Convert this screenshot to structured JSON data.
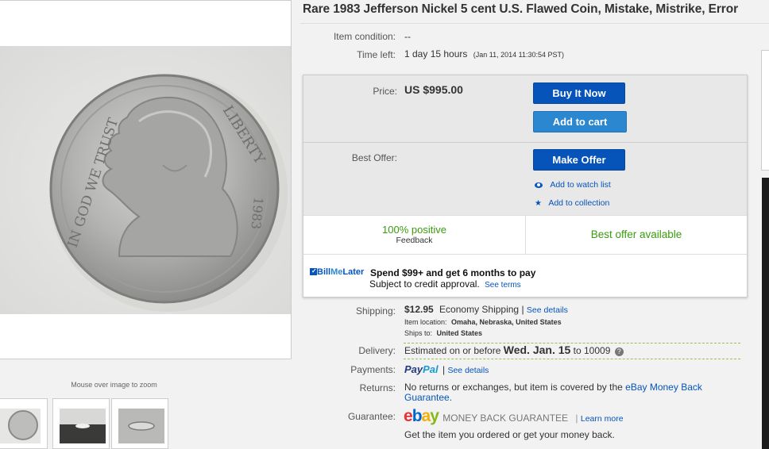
{
  "listing": {
    "title": "Rare 1983 Jefferson Nickel 5 cent U.S. Flawed Coin, Mistake, Mistrike, Error"
  },
  "gallery": {
    "zoom_hint": "Mouse over image to zoom",
    "coin_legend_left": "IN GOD WE TRUST",
    "coin_legend_right": "LIBERTY",
    "coin_year": "1983"
  },
  "details": {
    "item_condition_label": "Item condition:",
    "item_condition_value": "--",
    "time_left_label": "Time left:",
    "time_left_value": "1 day 15 hours",
    "time_left_end": "(Jan 11, 2014  11:30:54 PST)"
  },
  "buy_box": {
    "price_label": "Price:",
    "price_value": "US $995.00",
    "buy_now_label": "Buy It Now",
    "add_to_cart_label": "Add to cart",
    "best_offer_label": "Best Offer:",
    "make_offer_label": "Make Offer",
    "watch_label": "Add to watch list",
    "collection_label": "Add to collection",
    "feedback_percent": "100% positive",
    "feedback_label": "Feedback",
    "best_offer_available": "Best offer available",
    "bml_logo_bill": "Bill",
    "bml_logo_me": "Me",
    "bml_logo_later": "Later",
    "bml_headline": "Spend $99+ and get 6 months to pay",
    "bml_subtext": "Subject to credit approval.",
    "bml_terms_link": "See terms"
  },
  "shipping": {
    "shipping_label": "Shipping:",
    "shipping_cost": "$12.95",
    "shipping_method": "Economy Shipping |",
    "shipping_details_link": "See details",
    "item_location_label": "Item location:",
    "item_location_value": "Omaha, Nebraska, United States",
    "ships_to_label": "Ships to:",
    "ships_to_value": "United States",
    "delivery_label": "Delivery:",
    "delivery_prefix": "Estimated on or before",
    "delivery_date": "Wed. Jan. 15",
    "delivery_suffix": "to 10009",
    "payments_label": "Payments:",
    "paypal_pay": "Pay",
    "paypal_pal": "Pal",
    "payments_sep": "|",
    "payments_details_link": "See details",
    "returns_label": "Returns:",
    "returns_text": "No returns or exchanges, but item is covered by the",
    "returns_link": "eBay Money Back Guarantee.",
    "guarantee_label": "Guarantee:",
    "guarantee_brand_e": "e",
    "guarantee_brand_b": "b",
    "guarantee_brand_a": "a",
    "guarantee_brand_y": "y",
    "guarantee_program": "MONEY BACK GUARANTEE",
    "guarantee_learn_more": "Learn more",
    "guarantee_tagline": "Get the item you ordered or get your money back."
  },
  "colors": {
    "button_primary": "#0654ba",
    "button_secondary": "#2a87d0",
    "positive_green": "#3a9b0f",
    "ebay_red": "#e53238",
    "ebay_blue": "#0064d2",
    "ebay_yellow": "#f5af02",
    "ebay_green": "#86b817"
  },
  "icons": {
    "watch": "eye-icon",
    "collection": "star-icon",
    "delivery_help": "help-icon",
    "bml": "checkbox-icon"
  }
}
